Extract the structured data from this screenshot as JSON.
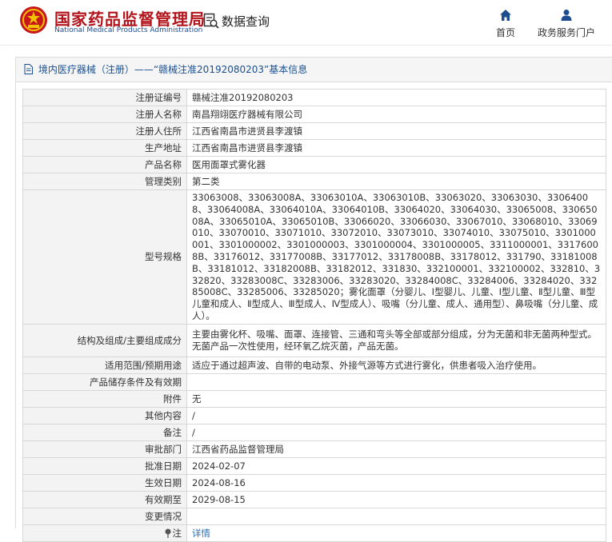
{
  "header": {
    "logo_cn": "国家药品监督管理局",
    "logo_en": "National Medical Products Administration",
    "query_label": "数据查询",
    "nav": [
      {
        "label": "首页",
        "icon": "home-icon"
      },
      {
        "label": "政务服务门户",
        "icon": "person-icon"
      }
    ]
  },
  "breadcrumb": {
    "text": "境内医疗器械（注册）——“赣械注准20192080203”基本信息"
  },
  "info": {
    "rows": [
      {
        "label": "注册证编号",
        "value": "赣械注准20192080203"
      },
      {
        "label": "注册人名称",
        "value": "南昌翔翊医疗器械有限公司"
      },
      {
        "label": "注册人住所",
        "value": "江西省南昌市进贤县李渡镇"
      },
      {
        "label": "生产地址",
        "value": "江西省南昌市进贤县李渡镇"
      },
      {
        "label": "产品名称",
        "value": "医用面罩式雾化器"
      },
      {
        "label": "管理类别",
        "value": "第二类"
      },
      {
        "label": "型号规格",
        "value": "33063008、33063008A、33063010A、33063010B、33063020、33063030、33064008、33064008A、33064010A、33064010B、33064020、33064030、33065008、33065008A、33065010A、33065010B、33066020、33066030、33067010、33068010、33069010、33070010、33071010、33072010、33073010、33074010、33075010、3301000001、3301000002、3301000003、3301000004、3301000005、3311000001、33176008B、33176012、33177008B、33177012、33178008B、33178012、331790、33181008B、33181012、33182008B、33182012、331830、332100001、332100002、332810、332820、33283008C、33283006、33283020、33284008C、33284006、33284020、33285008C、33285006、33285020；雾化面罩（分婴儿、Ⅰ型婴儿、儿童、Ⅰ型儿童、Ⅱ型儿童、Ⅲ型儿童和成人、Ⅱ型成人、Ⅲ型成人、Ⅳ型成人）、吸嘴（分儿童、成人、通用型）、鼻吸嘴（分儿童、成人）。"
      },
      {
        "label": "结构及组成/主要组成成分",
        "value": "主要由雾化杯、吸嘴、面罩、连接管、三通和弯头等全部或部分组成，分为无菌和非无菌两种型式。无菌产品一次性使用，经环氧乙烷灭菌，产品无菌。"
      },
      {
        "label": "适用范围/预期用途",
        "value": "适应于通过超声波、自带的电动泵、外接气源等方式进行雾化，供患者吸入治疗使用。"
      },
      {
        "label": "产品储存条件及有效期",
        "value": ""
      },
      {
        "label": "附件",
        "value": "无"
      },
      {
        "label": "其他内容",
        "value": "/"
      },
      {
        "label": "备注",
        "value": "/"
      },
      {
        "label": "审批部门",
        "value": "江西省药品监督管理局"
      },
      {
        "label": "批准日期",
        "value": "2024-02-07"
      },
      {
        "label": "生效日期",
        "value": "2024-08-16"
      },
      {
        "label": "有效期至",
        "value": "2029-08-15"
      },
      {
        "label": "变更情况",
        "value": ""
      },
      {
        "label": "注",
        "value": "详情"
      }
    ]
  },
  "colors": {
    "brand_red": "#b3141b",
    "brand_blue": "#1d4c8f",
    "link_blue": "#2c6fb4",
    "label_bg": "#f3f3f3"
  }
}
